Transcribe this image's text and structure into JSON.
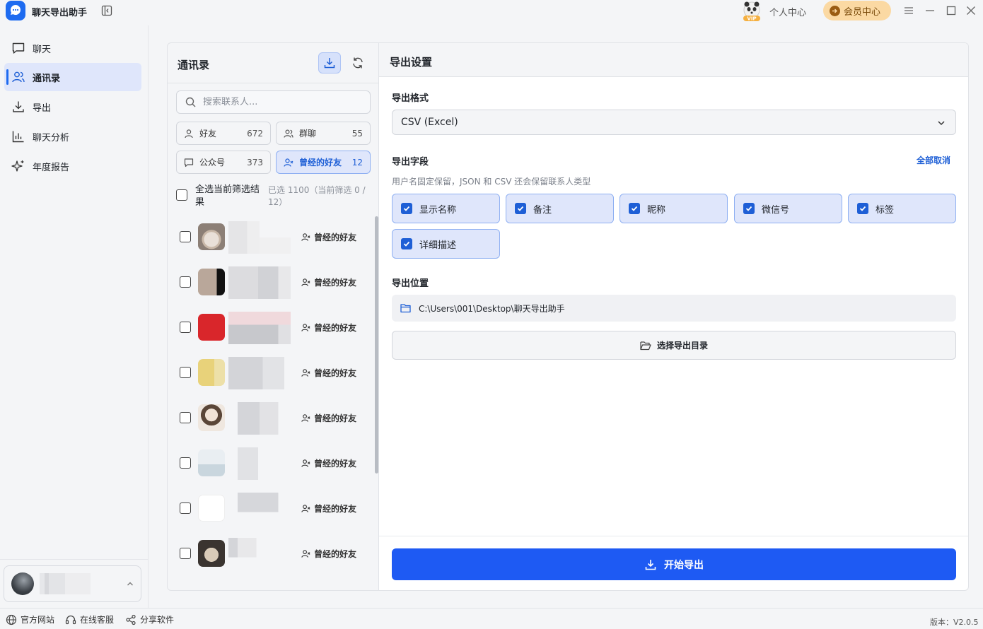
{
  "app": {
    "title": "聊天导出助手"
  },
  "header": {
    "personal_center": "个人中心",
    "member_center": "会员中心",
    "vip_badge": "VIP"
  },
  "sidebar": {
    "items": [
      {
        "label": "聊天",
        "icon": "chat-icon",
        "active": false
      },
      {
        "label": "通讯录",
        "icon": "contacts-icon",
        "active": true
      },
      {
        "label": "导出",
        "icon": "download-icon",
        "active": false
      },
      {
        "label": "聊天分析",
        "icon": "bar-chart-icon",
        "active": false
      },
      {
        "label": "年度报告",
        "icon": "sparkle-icon",
        "active": false
      }
    ]
  },
  "contacts": {
    "title": "通讯录",
    "search_placeholder": "搜索联系人...",
    "filters": [
      {
        "label": "好友",
        "count": "672",
        "icon": "person-icon",
        "active": false
      },
      {
        "label": "群聊",
        "count": "55",
        "icon": "group-icon",
        "active": false
      },
      {
        "label": "公众号",
        "count": "373",
        "icon": "message-square-icon",
        "active": false
      },
      {
        "label": "曾经的好友",
        "count": "12",
        "icon": "user-x-icon",
        "active": true
      }
    ],
    "select_all_label": "全选当前筛选结果",
    "selected_info": "已选 1100（当前筛选 0 / 12）",
    "rows": [
      {
        "tag": "曾经的好友"
      },
      {
        "tag": "曾经的好友"
      },
      {
        "tag": "曾经的好友"
      },
      {
        "tag": "曾经的好友"
      },
      {
        "tag": "曾经的好友"
      },
      {
        "tag": "曾经的好友"
      },
      {
        "tag": "曾经的好友"
      },
      {
        "tag": "曾经的好友"
      }
    ]
  },
  "export": {
    "title": "导出设置",
    "format_label": "导出格式",
    "format_value": "CSV (Excel)",
    "fields_label": "导出字段",
    "deselect_all": "全部取消",
    "fields_hint": "用户名固定保留，JSON 和 CSV 还会保留联系人类型",
    "fields": [
      {
        "label": "显示名称",
        "checked": true
      },
      {
        "label": "备注",
        "checked": true
      },
      {
        "label": "昵称",
        "checked": true
      },
      {
        "label": "微信号",
        "checked": true
      },
      {
        "label": "标签",
        "checked": true
      },
      {
        "label": "详细描述",
        "checked": true
      }
    ],
    "location_label": "导出位置",
    "path": "C:\\Users\\001\\Desktop\\聊天导出助手",
    "choose_dir": "选择导出目录",
    "start_export": "开始导出"
  },
  "statusbar": {
    "official_site": "官方网站",
    "online_service": "在线客服",
    "share": "分享软件",
    "version": "版本：V2.0.5"
  },
  "colors": {
    "accent": "#1e5af3",
    "active_bg": "#dfe6fb",
    "member_bg": "#fbd9a3"
  }
}
